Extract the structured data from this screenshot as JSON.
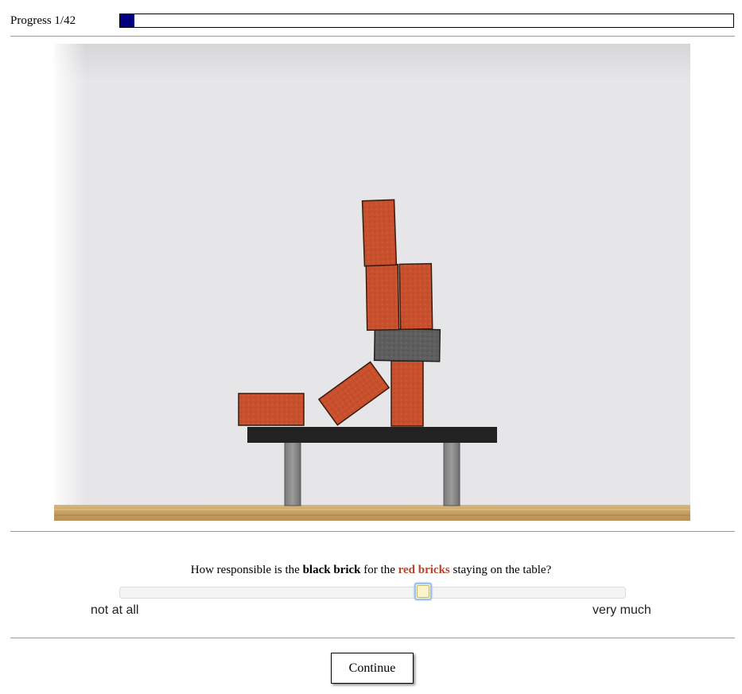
{
  "header": {
    "progress_label": "Progress 1/42",
    "progress_fraction": 0.0238
  },
  "scene": {
    "image_description_icon": "brick-stack-scene",
    "colors": {
      "red_brick": "#c8502c",
      "black_brick": "#595959",
      "table_top": "#222222",
      "table_leg": "#8a8a8a",
      "floor": "#caa56a",
      "wall": "#e6e6e8"
    }
  },
  "question": {
    "prefix": "How responsible is the ",
    "black_brick": "black brick",
    "middle": " for the ",
    "red_bricks": "red bricks",
    "suffix": " staying on the table?",
    "red_color": "#b5452a"
  },
  "slider": {
    "value": 0.6,
    "min_label": "not at all",
    "max_label": "very much"
  },
  "actions": {
    "continue_label": "Continue"
  }
}
